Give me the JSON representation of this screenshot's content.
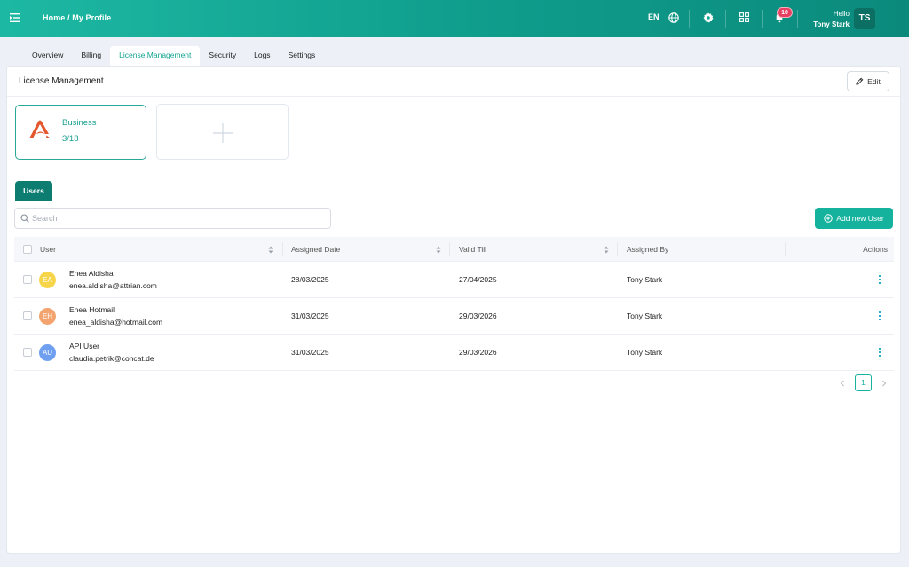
{
  "topbar": {
    "breadcrumb": [
      "Home",
      "/",
      "My Profile"
    ],
    "language": "EN",
    "notification_count": "10",
    "greeting": "Hello",
    "user_name": "Tony Stark",
    "user_initials": "TS"
  },
  "tabs": [
    {
      "label": "Overview",
      "active": false
    },
    {
      "label": "Billing",
      "active": false
    },
    {
      "label": "License Management",
      "active": true
    },
    {
      "label": "Security",
      "active": false
    },
    {
      "label": "Logs",
      "active": false
    },
    {
      "label": "Settings",
      "active": false
    }
  ],
  "panel": {
    "title": "License Management",
    "edit_label": "Edit"
  },
  "license_card": {
    "name": "Business",
    "count": "3/18"
  },
  "users_tab": "Users",
  "search": {
    "placeholder": "Search",
    "value": ""
  },
  "add_user_label": "Add new User",
  "table": {
    "headers": {
      "user": "User",
      "assigned_date": "Assigned Date",
      "valid_till": "Valid Till",
      "assigned_by": "Assigned By",
      "actions": "Actions"
    },
    "rows": [
      {
        "initials": "EA",
        "avatar_color": "#f7d54a",
        "name": "Enea Aldisha",
        "email": "enea.aldisha@attrian.com",
        "assigned_date": "28/03/2025",
        "valid_till": "27/04/2025",
        "assigned_by": "Tony Stark"
      },
      {
        "initials": "EH",
        "avatar_color": "#f3a46e",
        "name": "Enea Hotmail",
        "email": "enea_aldisha@hotmail.com",
        "assigned_date": "31/03/2025",
        "valid_till": "29/03/2026",
        "assigned_by": "Tony Stark"
      },
      {
        "initials": "AU",
        "avatar_color": "#6f9ff0",
        "name": "API User",
        "email": "claudia.petrik@concat.de",
        "assigned_date": "31/03/2025",
        "valid_till": "29/03/2026",
        "assigned_by": "Tony Stark"
      }
    ]
  },
  "pagination": {
    "current_page": "1"
  },
  "colors": {
    "brand_teal": "#15b39e",
    "dark_teal": "#0c7d70",
    "notification_red": "#e83e5f",
    "license_logo_orange": "#e4572e"
  }
}
